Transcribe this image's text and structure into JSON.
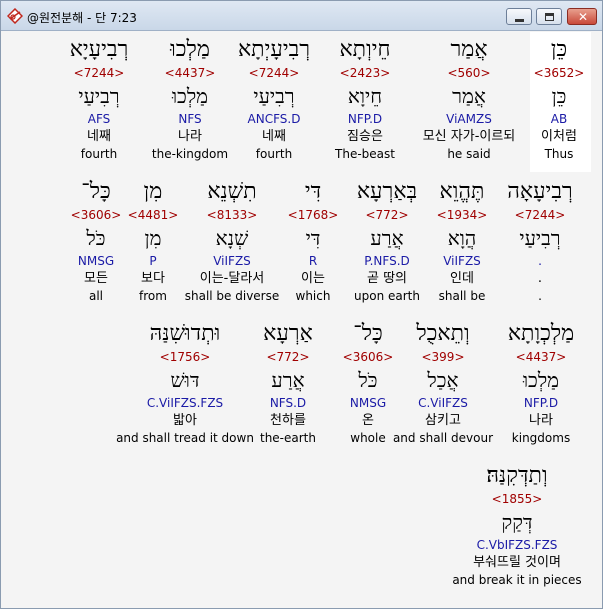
{
  "window": {
    "title": "@원전분해 - 단 7:23",
    "icon": "app-logo-icon"
  },
  "controls": {
    "minimize_icon": "minimize-icon",
    "maximize_icon": "maximize-icon",
    "close_icon": "close-icon",
    "close_glyph": "✕"
  },
  "rows": [
    {
      "words": [
        {
          "heb": "כֵּן",
          "num": "<3652>",
          "lemma": "כֵּן",
          "code": "AB",
          "kor": "이처럼",
          "eng": "Thus"
        },
        {
          "heb": "אֲמַר",
          "num": "<560>",
          "lemma": "אֲמַר",
          "code": "ViAMZS",
          "kor": "모신 자가-이르되",
          "eng": "he said"
        },
        {
          "heb": "חֵיוְתָא",
          "num": "<2423>",
          "lemma": "חֵיוָא",
          "code": "NFP.D",
          "kor": "짐승은",
          "eng": "The-beast"
        },
        {
          "heb": "רְבִיעָיְתָא",
          "num": "<7244>",
          "lemma": "רְבִיעַי",
          "code": "ANCFS.D",
          "kor": "네째",
          "eng": "fourth"
        },
        {
          "heb": "מַלְכוּ",
          "num": "<4437>",
          "lemma": "מַלְכוּ",
          "code": "NFS",
          "kor": "나라",
          "eng": "the-kingdom"
        },
        {
          "heb": "רְבִיעָיָא",
          "num": "<7244>",
          "lemma": "רְבִיעַי",
          "code": "AFS",
          "kor": "네째",
          "eng": "fourth"
        }
      ]
    },
    {
      "words": [
        {
          "heb": "רְבִיעָאָה",
          "num": "<7244>",
          "lemma": "רְבִיעַי",
          "code": ".",
          "kor": ".",
          "eng": "."
        },
        {
          "heb": "תֶּהֱוֵא",
          "num": "<1934>",
          "lemma": "הֲוָא",
          "code": "ViIFZS",
          "kor": "인데",
          "eng": "shall be"
        },
        {
          "heb": "בְּאַרְעָא",
          "num": "<772>",
          "lemma": "אֲרַע",
          "code": "P.NFS.D",
          "kor": "곧 땅의",
          "eng": "upon earth"
        },
        {
          "heb": "דִּי",
          "num": "<1768>",
          "lemma": "דִּי",
          "code": "R",
          "kor": "이는",
          "eng": "which"
        },
        {
          "heb": "תִשְׁנֵא",
          "num": "<8133>",
          "lemma": "שְׁנָא",
          "code": "ViIFZS",
          "kor": "이는-달라서",
          "eng": "shall be diverse"
        },
        {
          "heb": "מִן",
          "num": "<4481>",
          "lemma": "מִן",
          "code": "P",
          "kor": "보다",
          "eng": "from"
        },
        {
          "heb": "כָּל־",
          "num": "<3606>",
          "lemma": "כֹּל",
          "code": "NMSG",
          "kor": "모든",
          "eng": "all"
        }
      ]
    },
    {
      "words": [
        {
          "heb": "מַלְכְוָתָא",
          "num": "<4437>",
          "lemma": "מַלְכוּ",
          "code": "NFP.D",
          "kor": "나라",
          "eng": "kingdoms"
        },
        {
          "heb": "וְתֵאכֻל",
          "num": "<399>",
          "lemma": "אֲכַל",
          "code": "C.ViIFZS",
          "kor": "삼키고",
          "eng": "and shall devour"
        },
        {
          "heb": "כָּל־",
          "num": "<3606>",
          "lemma": "כֹּל",
          "code": "NMSG",
          "kor": "온",
          "eng": "whole"
        },
        {
          "heb": "אַרְעָא",
          "num": "<772>",
          "lemma": "אֲרַע",
          "code": "NFS.D",
          "kor": "천하를",
          "eng": "the-earth"
        },
        {
          "heb": "וּתְדוּשִׁנַּהּ",
          "num": "<1756>",
          "lemma": "דּוּשׁ",
          "code": "C.ViIFZS.FZS",
          "kor": "밟아",
          "eng": "and shall tread it down"
        }
      ]
    },
    {
      "words": [
        {
          "heb": "וְתַדְּקִנַּהּ׃",
          "num": "<1855>",
          "lemma": "דְּקַק",
          "code": "C.VbIFZS.FZS",
          "kor": "부숴뜨릴 것이며",
          "eng": "and break it in pieces"
        }
      ]
    }
  ]
}
